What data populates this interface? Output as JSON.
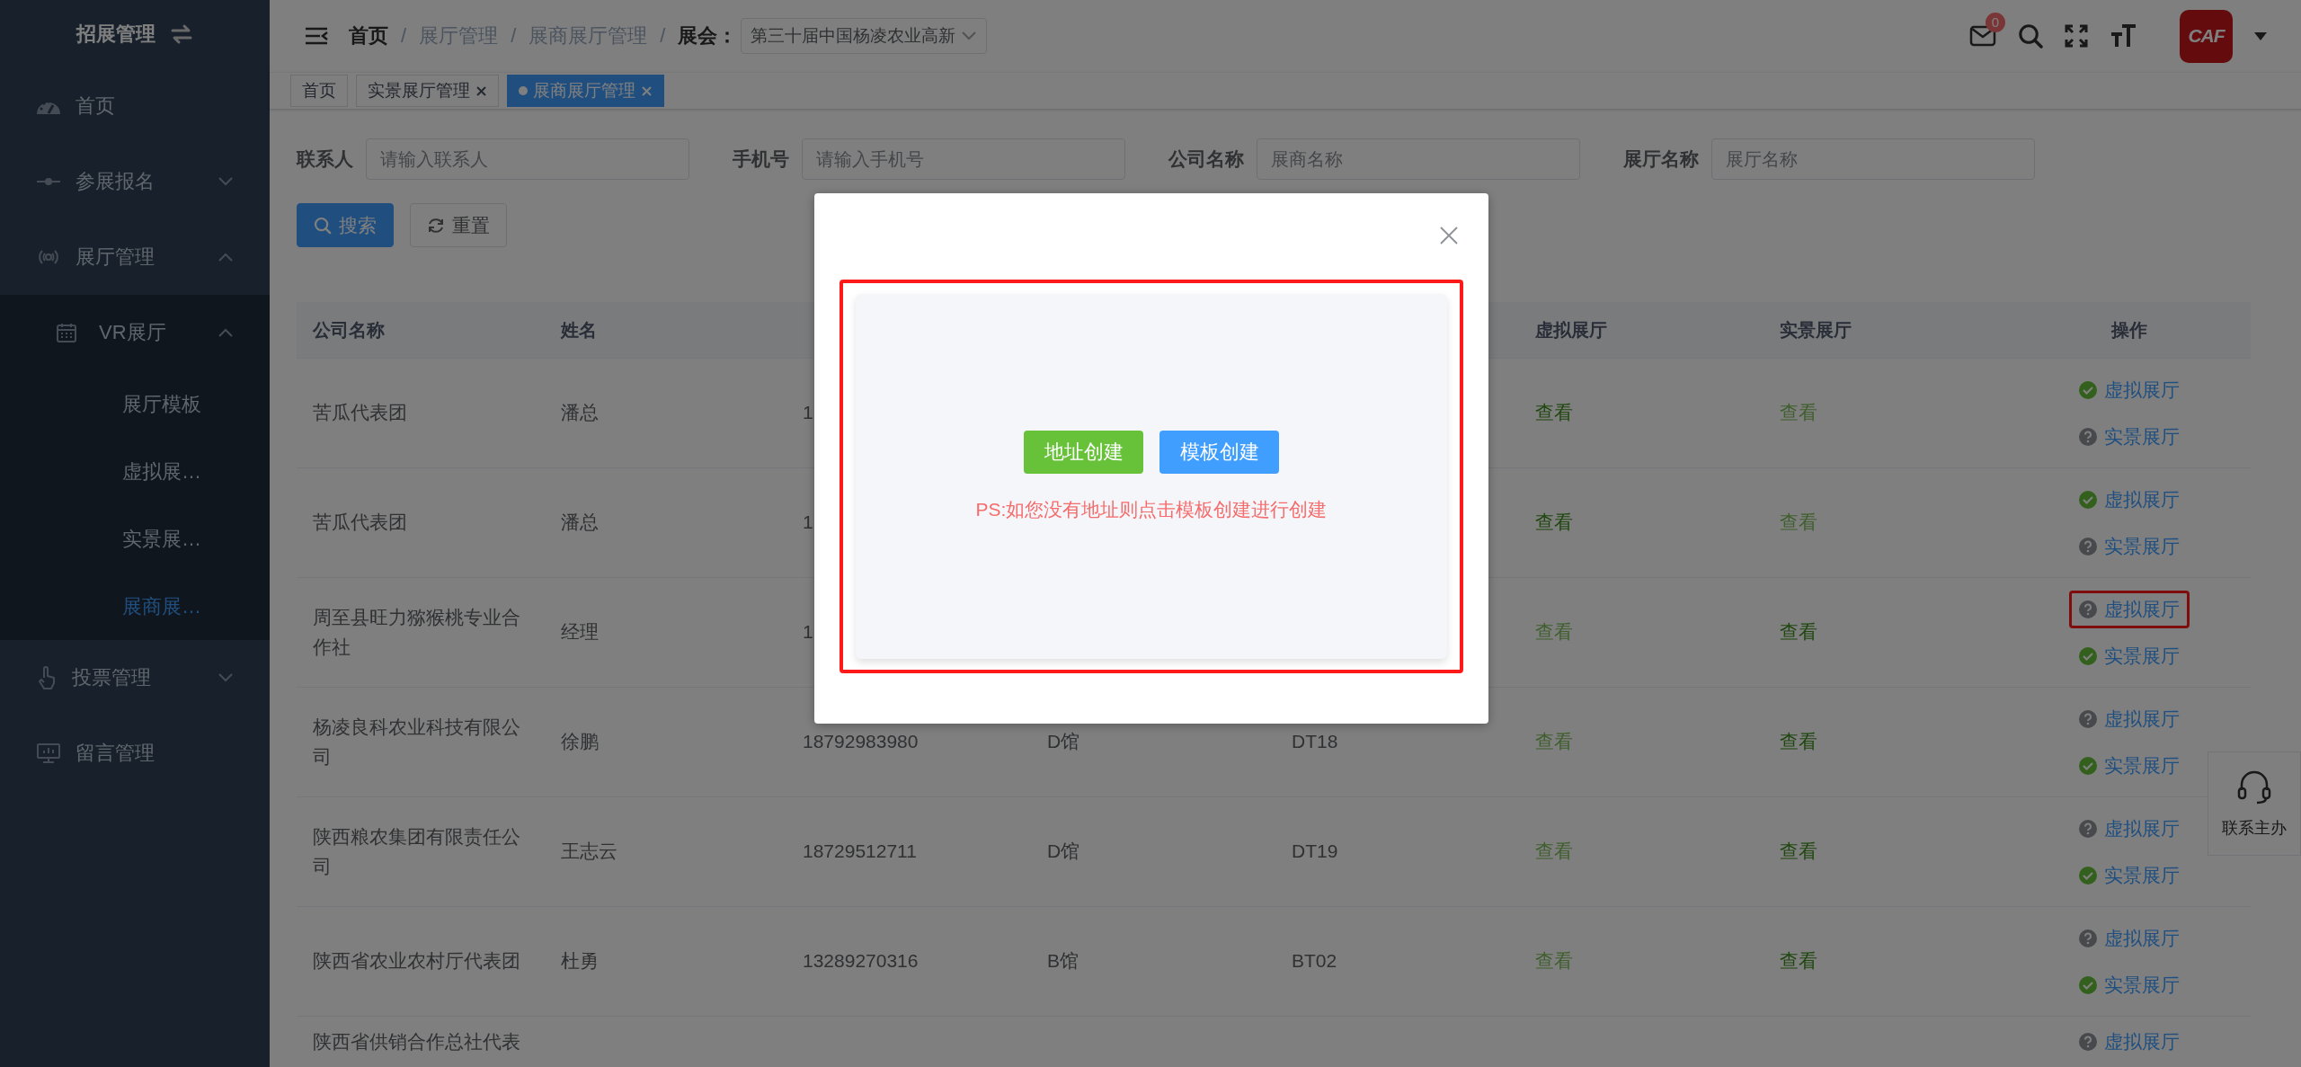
{
  "sidebar": {
    "title": "招展管理",
    "menu": [
      {
        "label": "首页",
        "selected": false
      },
      {
        "label": "参展报名",
        "expanded": false
      },
      {
        "label": "展厅管理",
        "expanded": true,
        "children": [
          {
            "label": "VR展厅",
            "expanded": true,
            "children": [
              {
                "label": "展厅模板",
                "selected": false
              },
              {
                "label": "虚拟展…",
                "selected": false
              },
              {
                "label": "实景展…",
                "selected": false
              },
              {
                "label": "展商展…",
                "selected": true
              }
            ]
          }
        ]
      },
      {
        "label": "投票管理",
        "expanded": false
      },
      {
        "label": "留言管理",
        "selected": false
      }
    ]
  },
  "header": {
    "breadcrumb": [
      {
        "label": "首页",
        "linked": true
      },
      {
        "separator": "/",
        "label": "展厅管理",
        "linked": false
      },
      {
        "separator": "/",
        "label": "展商展厅管理",
        "linked": false
      }
    ],
    "event": {
      "separator": "/",
      "label": "展会：",
      "value": "第三十届中国杨凌农业高新"
    },
    "mail_badge": "0",
    "avatar_text": "CAF"
  },
  "tabs": [
    {
      "label": "首页",
      "closable": false,
      "selected": false
    },
    {
      "label": "实景展厅管理",
      "closable": true,
      "selected": false
    },
    {
      "label": "展商展厅管理",
      "closable": true,
      "selected": true
    }
  ],
  "filters": [
    {
      "label": "联系人",
      "placeholder": "请输入联系人"
    },
    {
      "label": "手机号",
      "placeholder": "请输入手机号"
    },
    {
      "label": "公司名称",
      "placeholder": "展商名称"
    },
    {
      "label": "展厅名称",
      "placeholder": "展厅名称"
    }
  ],
  "buttons": [
    {
      "label": "搜索",
      "kind": "primary"
    },
    {
      "label": "重置",
      "kind": "default"
    }
  ],
  "table": {
    "columns": {
      "company": "公司名称",
      "name": "姓名",
      "virtual_view": "虚拟展厅",
      "real_view": "实景展厅",
      "actions": "操作"
    },
    "rows": [
      {
        "company": "苦瓜代表团",
        "name": "潘总",
        "phone": "1",
        "virtual_view": {
          "label": "查看",
          "enabled": true
        },
        "real_view": {
          "label": "查看",
          "enabled": false
        },
        "actions": [
          {
            "label": "虚拟展厅",
            "done": true,
            "highlighted": false
          },
          {
            "label": "实景展厅",
            "done": false,
            "highlighted": false
          }
        ]
      },
      {
        "company": "苦瓜代表团",
        "name": "潘总",
        "phone": "1",
        "virtual_view": {
          "label": "查看",
          "enabled": true
        },
        "real_view": {
          "label": "查看",
          "enabled": false
        },
        "actions": [
          {
            "label": "虚拟展厅",
            "done": true,
            "highlighted": false
          },
          {
            "label": "实景展厅",
            "done": false,
            "highlighted": false
          }
        ]
      },
      {
        "company": "周至县旺力猕猴桃专业合作社",
        "name": "经理",
        "phone": "1",
        "virtual_view": {
          "label": "查看",
          "enabled": false
        },
        "real_view": {
          "label": "查看",
          "enabled": true
        },
        "actions": [
          {
            "label": "虚拟展厅",
            "done": false,
            "highlighted": true
          },
          {
            "label": "实景展厅",
            "done": true,
            "highlighted": false
          }
        ]
      },
      {
        "company": "杨凌良科农业科技有限公司",
        "name": "徐鹏",
        "phone": "18792983980",
        "hall": "D馆",
        "booth": "DT18",
        "virtual_view": {
          "label": "查看",
          "enabled": false
        },
        "real_view": {
          "label": "查看",
          "enabled": true
        },
        "actions": [
          {
            "label": "虚拟展厅",
            "done": false,
            "highlighted": false
          },
          {
            "label": "实景展厅",
            "done": true,
            "highlighted": false
          }
        ]
      },
      {
        "company": "陕西粮农集团有限责任公司",
        "name": "王志云",
        "phone": "18729512711",
        "hall": "D馆",
        "booth": "DT19",
        "virtual_view": {
          "label": "查看",
          "enabled": false
        },
        "real_view": {
          "label": "查看",
          "enabled": true
        },
        "actions": [
          {
            "label": "虚拟展厅",
            "done": false,
            "highlighted": false
          },
          {
            "label": "实景展厅",
            "done": true,
            "highlighted": false
          }
        ]
      },
      {
        "company": "陕西省农业农村厅代表团",
        "name": "杜勇",
        "phone": "13289270316",
        "hall": "B馆",
        "booth": "BT02",
        "virtual_view": {
          "label": "查看",
          "enabled": false
        },
        "real_view": {
          "label": "查看",
          "enabled": true
        },
        "actions": [
          {
            "label": "虚拟展厅",
            "done": false,
            "highlighted": false
          },
          {
            "label": "实景展厅",
            "done": true,
            "highlighted": false
          }
        ]
      },
      {
        "company": "陕西省供销合作总社代表",
        "actions": [
          {
            "label": "虚拟展厅",
            "done": false,
            "highlighted": false
          }
        ]
      }
    ]
  },
  "contact": {
    "label": "联系主办"
  },
  "dialog": {
    "highlighted": true,
    "buttons": [
      {
        "label": "地址创建",
        "kind": "success"
      },
      {
        "label": "模板创建",
        "kind": "primary"
      }
    ],
    "note": "PS:如您没有地址则点击模板创建进行创建"
  }
}
